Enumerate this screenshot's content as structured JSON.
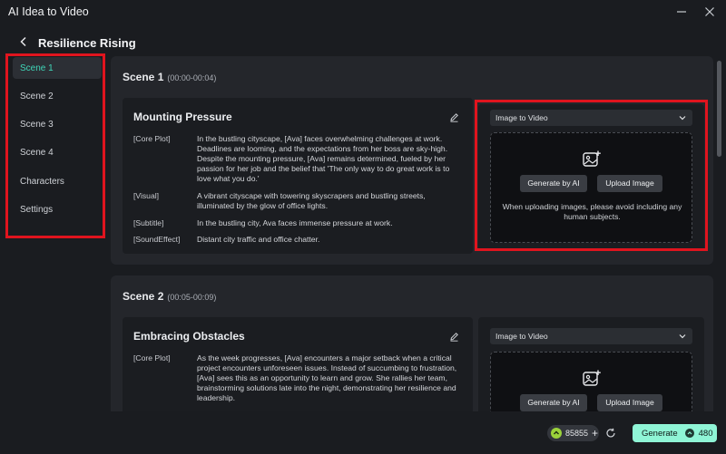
{
  "window": {
    "title": "AI Idea to Video"
  },
  "header": {
    "title": "Resilience Rising"
  },
  "sidebar": {
    "items": [
      {
        "label": "Scene 1",
        "active": true
      },
      {
        "label": "Scene 2",
        "active": false
      },
      {
        "label": "Scene 3",
        "active": false
      },
      {
        "label": "Scene 4",
        "active": false
      },
      {
        "label": "Characters",
        "active": false
      },
      {
        "label": "Settings",
        "active": false
      }
    ]
  },
  "scenes": [
    {
      "label": "Scene 1",
      "time": "(00:00-00:04)",
      "title": "Mounting Pressure",
      "fields": [
        {
          "label": "[Core Plot]",
          "value": "In the bustling cityscape, [Ava] faces overwhelming challenges at work. Deadlines are looming, and the expectations from her boss are sky-high. Despite the mounting pressure, [Ava] remains determined, fueled by her passion for her job and the belief that 'The only way to do great work is to love what you do.'"
        },
        {
          "label": "[Visual]",
          "value": "A vibrant cityscape with towering skyscrapers and bustling streets, illuminated by the glow of office lights."
        },
        {
          "label": "[Subtitle]",
          "value": "In the bustling city, Ava faces immense pressure at work."
        },
        {
          "label": "[SoundEffect]",
          "value": "Distant city traffic and office chatter."
        }
      ],
      "mode": "Image to Video",
      "generate_ai_label": "Generate by AI",
      "upload_label": "Upload Image",
      "hint": "When uploading images, please avoid including any human subjects."
    },
    {
      "label": "Scene 2",
      "time": "(00:05-00:09)",
      "title": "Embracing Obstacles",
      "fields": [
        {
          "label": "[Core Plot]",
          "value": "As the week progresses, [Ava] encounters a major setback when a critical project encounters unforeseen issues. Instead of succumbing to frustration, [Ava] sees this as an opportunity to learn and grow. She rallies her team, brainstorming solutions late into the night, demonstrating her resilience and leadership."
        }
      ],
      "mode": "Image to Video",
      "generate_ai_label": "Generate by AI",
      "upload_label": "Upload Image"
    }
  ],
  "footer": {
    "credits": "85855",
    "generate_label": "Generate",
    "generate_cost": "480"
  },
  "colors": {
    "accent": "#3fd6b8",
    "generate_bg": "#8ff5d6",
    "highlight": "#e0141e",
    "coin": "#9bd33a"
  }
}
